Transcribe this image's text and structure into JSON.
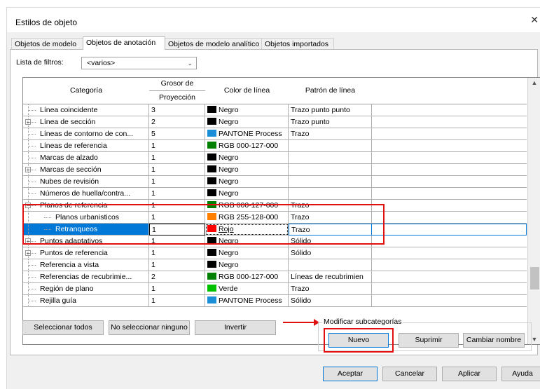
{
  "window": {
    "title": "Estilos de objeto",
    "close_glyph": "✕"
  },
  "tabs": [
    {
      "label": "Objetos de modelo"
    },
    {
      "label": "Objetos de anotación"
    },
    {
      "label": "Objetos de modelo analítico"
    },
    {
      "label": "Objetos importados"
    }
  ],
  "filter": {
    "label": "Lista de filtros:",
    "value": "<varios>"
  },
  "columns": {
    "category": "Categoría",
    "thickness_group": "Grosor de",
    "projection": "Proyección",
    "line_color": "Color de línea",
    "line_pattern": "Patrón de línea"
  },
  "rows": [
    {
      "category": "Línea coincidente",
      "thickness": "3",
      "color": "Negro",
      "swatch": "#000000",
      "pattern": "Trazo punto punto"
    },
    {
      "category": "Línea de sección",
      "thickness": "2",
      "color": "Negro",
      "swatch": "#000000",
      "pattern": "Trazo punto"
    },
    {
      "category": "Líneas de contorno de con...",
      "thickness": "5",
      "color": "PANTONE Process",
      "swatch": "#1a8fd8",
      "pattern": "Trazo"
    },
    {
      "category": "Líneas de referencia",
      "thickness": "1",
      "color": "RGB 000-127-000",
      "swatch": "#007f00",
      "pattern": ""
    },
    {
      "category": "Marcas de alzado",
      "thickness": "1",
      "color": "Negro",
      "swatch": "#000000",
      "pattern": ""
    },
    {
      "category": "Marcas de sección",
      "thickness": "1",
      "color": "Negro",
      "swatch": "#000000",
      "pattern": ""
    },
    {
      "category": "Nubes de revisión",
      "thickness": "1",
      "color": "Negro",
      "swatch": "#000000",
      "pattern": ""
    },
    {
      "category": "Números de huella/contra...",
      "thickness": "1",
      "color": "Negro",
      "swatch": "#000000",
      "pattern": ""
    },
    {
      "category": "Planos de referencia",
      "thickness": "1",
      "color": "RGB 000-127-000",
      "swatch": "#007f00",
      "pattern": "Trazo"
    },
    {
      "category": "Planos urbanisticos",
      "thickness": "1",
      "color": "RGB 255-128-000",
      "swatch": "#ff8000",
      "pattern": "Trazo"
    },
    {
      "category": "Retranqueos",
      "thickness": "1",
      "color": "Rojo",
      "swatch": "#ff0000",
      "pattern": "Trazo"
    },
    {
      "category": "Puntos adaptativos",
      "thickness": "1",
      "color": "Negro",
      "swatch": "#000000",
      "pattern": "Sólido"
    },
    {
      "category": "Puntos de referencia",
      "thickness": "1",
      "color": "Negro",
      "swatch": "#000000",
      "pattern": "Sólido"
    },
    {
      "category": "Referencia a vista",
      "thickness": "1",
      "color": "Negro",
      "swatch": "#000000",
      "pattern": ""
    },
    {
      "category": "Referencias de recubrimie...",
      "thickness": "2",
      "color": "RGB 000-127-000",
      "swatch": "#007f00",
      "pattern": "Líneas de recubrimien"
    },
    {
      "category": "Región de plano",
      "thickness": "1",
      "color": "Verde",
      "swatch": "#00c000",
      "pattern": "Trazo"
    },
    {
      "category": "Rejilla guía",
      "thickness": "1",
      "color": "PANTONE Process",
      "swatch": "#1a8fd8",
      "pattern": "Sólido"
    }
  ],
  "buttons": {
    "select_all": "Seleccionar todos",
    "select_none": "No seleccionar ninguno",
    "invert": "Invertir",
    "subcat_group": "Modificar subcategorías",
    "new": "Nuevo",
    "delete": "Suprimir",
    "rename": "Cambiar nombre",
    "ok": "Aceptar",
    "cancel": "Cancelar",
    "apply": "Aplicar",
    "help": "Ayuda"
  },
  "colors": {
    "highlight": "#e01010",
    "selection": "#0078d7"
  }
}
